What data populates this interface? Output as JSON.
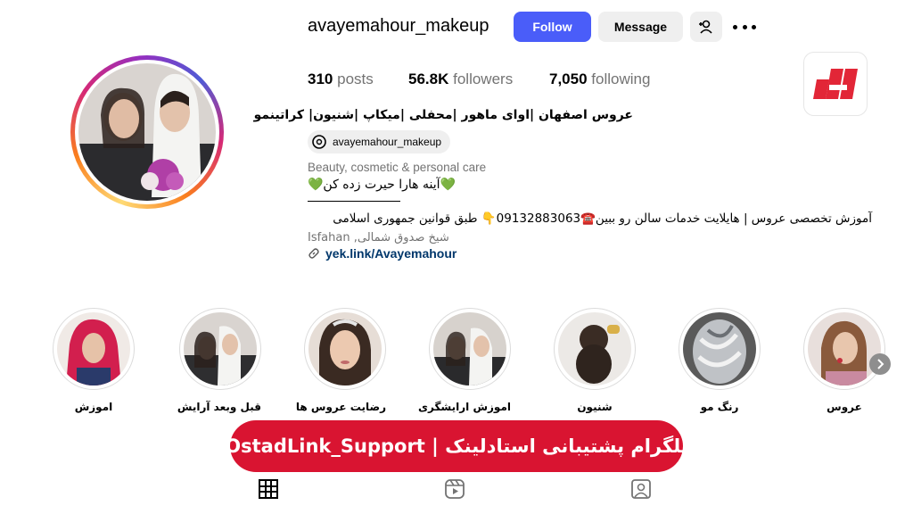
{
  "profile": {
    "username": "avayemahour_makeup",
    "follow_label": "Follow",
    "message_label": "Message",
    "stats": [
      {
        "count": "310",
        "label": "posts"
      },
      {
        "count": "56.8K",
        "label": "followers"
      },
      {
        "count": "7,050",
        "label": "following"
      }
    ],
    "full_name": "عروس اصفهان |اوای ماهور |محفلی |میکاپ |شنیون| کراتینمو",
    "threads_handle": "avayemahour_makeup",
    "category": "Beauty, cosmetic & personal care",
    "bio_line1": "💚آینه هارا حیرت زده کن💚",
    "bio_line2": "آموزش تخصصی عروس | هایلایت خدمات سالن رو ببین☎️09132883063👇 طبق قوانین جمهوری اسلامی",
    "address": "Isfahan ,شیخ صدوق شمالی",
    "link": "yek.link/Avayemahour"
  },
  "highlights": [
    {
      "label": "عروس"
    },
    {
      "label": "رنگ مو"
    },
    {
      "label": "شنیون"
    },
    {
      "label": "اموزش ارایشگری"
    },
    {
      "label": "رضایت عروس ها"
    },
    {
      "label": "قبل وبعد آرایش"
    },
    {
      "label": "اموزش"
    }
  ],
  "banner": {
    "text": "تلگرام پشتیبانی استادلینک | OstadLink_Support"
  },
  "colors": {
    "follow": "#4a5df9",
    "banner": "#d91431",
    "link": "#00376b"
  },
  "icons": [
    "add-user-icon",
    "more-icon",
    "threads-icon",
    "link-icon",
    "chevron-right-icon",
    "grid-icon",
    "reels-icon",
    "tagged-icon"
  ]
}
